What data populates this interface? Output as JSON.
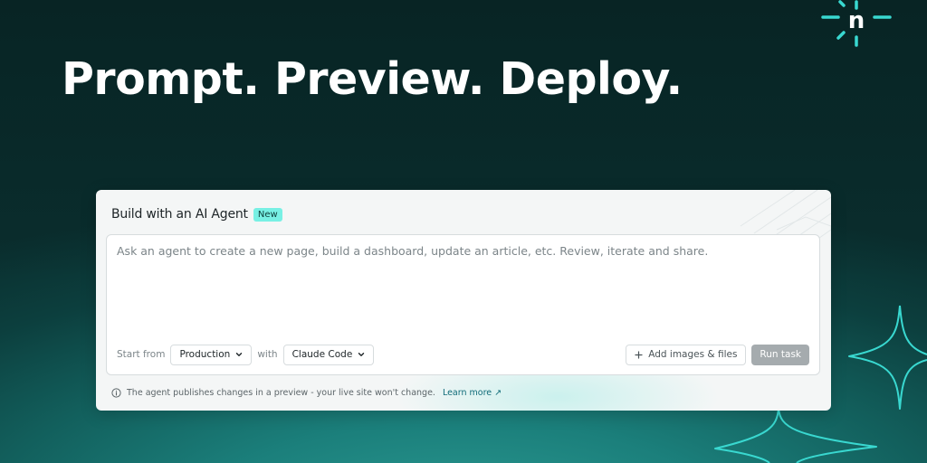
{
  "headline": "Prompt. Preview. Deploy.",
  "brand": {
    "logo_letter": "n",
    "accent": "#39d8d0"
  },
  "card": {
    "title": "Build with an AI Agent",
    "badge": "New",
    "prompt_placeholder": "Ask an agent to create a new page, build a dashboard, update an article, etc. Review, iterate and share.",
    "start_from_label": "Start from",
    "start_from_value": "Production",
    "with_label": "with",
    "agent_value": "Claude Code",
    "add_files_label": "Add images & files",
    "run_label": "Run task",
    "note": "The agent publishes changes in a preview - your live site won't change.",
    "learn_more": "Learn more ↗"
  },
  "icons": {
    "logo": "netlify-logo-icon",
    "chevron": "chevron-down-icon",
    "plus": "plus-icon",
    "info": "info-icon",
    "sparkle": "sparkle-star-icon"
  },
  "colors": {
    "badge_bg": "#78f0e4",
    "run_button_disabled": "#a5abae",
    "link": "#0f6b78",
    "sparkle_outline": "#39d8d0"
  }
}
